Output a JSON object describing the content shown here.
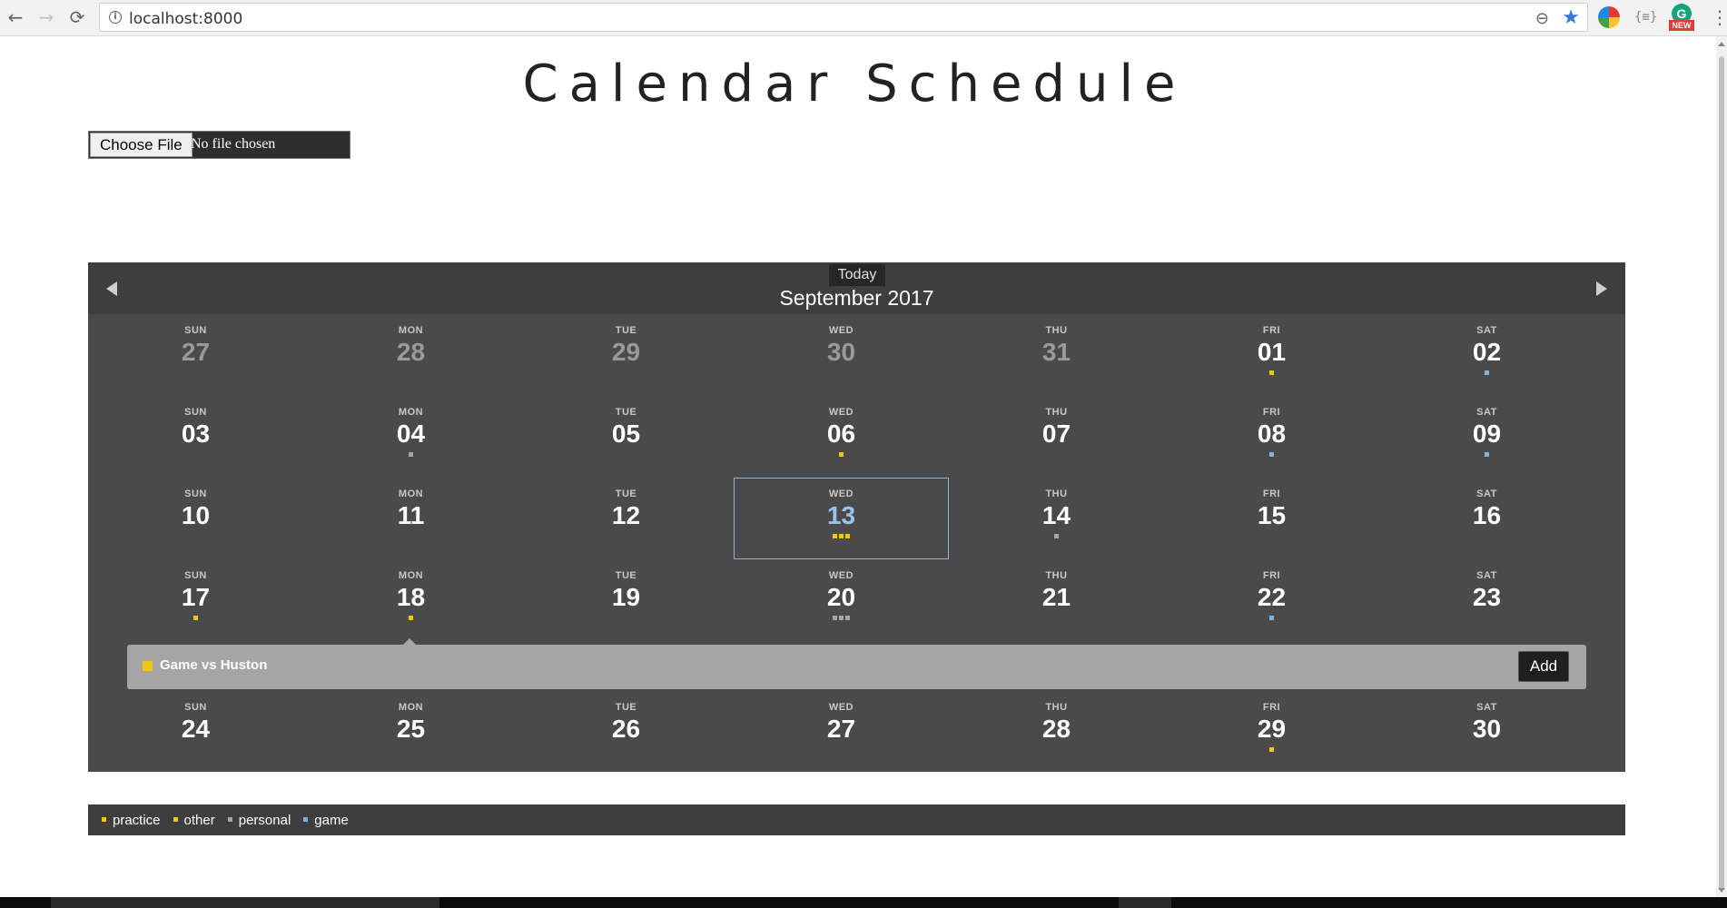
{
  "browser": {
    "url": "localhost:8000",
    "info_icon": "i",
    "back_icon": "←",
    "forward_icon": "→",
    "reload_icon": "⟳",
    "zoom_icon": "⊖",
    "star_icon": "★",
    "menu_icon": "⋮",
    "braces_icon": "{≡}",
    "grammarly_letter": "G",
    "grammarly_badge": "NEW"
  },
  "page": {
    "title": "Calendar Schedule",
    "file_input": {
      "button_label": "Choose File",
      "status": "No file chosen"
    }
  },
  "colors": {
    "practice": "#f0c419",
    "other": "#f0c419",
    "personal": "#a6a6a6",
    "game": "#7fb2e5"
  },
  "calendar": {
    "today_label": "Today",
    "month_label": "September 2017",
    "prev_icon": "triangle-left",
    "next_icon": "triangle-right",
    "weeks": [
      [
        {
          "name": "SUN",
          "num": "27",
          "other": true,
          "dots": []
        },
        {
          "name": "MON",
          "num": "28",
          "other": true,
          "dots": []
        },
        {
          "name": "TUE",
          "num": "29",
          "other": true,
          "dots": []
        },
        {
          "name": "WED",
          "num": "30",
          "other": true,
          "dots": []
        },
        {
          "name": "THU",
          "num": "31",
          "other": true,
          "dots": []
        },
        {
          "name": "FRI",
          "num": "01",
          "dots": [
            "#f0c419"
          ]
        },
        {
          "name": "SAT",
          "num": "02",
          "dots": [
            "#7fb2e5"
          ]
        }
      ],
      [
        {
          "name": "SUN",
          "num": "03",
          "dots": []
        },
        {
          "name": "MON",
          "num": "04",
          "dots": [
            "#a6a6a6"
          ]
        },
        {
          "name": "TUE",
          "num": "05",
          "dots": []
        },
        {
          "name": "WED",
          "num": "06",
          "dots": [
            "#f0c419"
          ]
        },
        {
          "name": "THU",
          "num": "07",
          "dots": []
        },
        {
          "name": "FRI",
          "num": "08",
          "dots": [
            "#7fb2e5"
          ]
        },
        {
          "name": "SAT",
          "num": "09",
          "dots": [
            "#7fb2e5"
          ]
        }
      ],
      [
        {
          "name": "SUN",
          "num": "10",
          "dots": []
        },
        {
          "name": "MON",
          "num": "11",
          "dots": []
        },
        {
          "name": "TUE",
          "num": "12",
          "dots": []
        },
        {
          "name": "WED",
          "num": "13",
          "selected": true,
          "dots": [
            "#f0c419",
            "#f0c419",
            "#f0c419"
          ]
        },
        {
          "name": "THU",
          "num": "14",
          "dots": [
            "#a6a6a6"
          ]
        },
        {
          "name": "FRI",
          "num": "15",
          "dots": []
        },
        {
          "name": "SAT",
          "num": "16",
          "dots": []
        }
      ],
      [
        {
          "name": "SUN",
          "num": "17",
          "dots": [
            "#f0c419"
          ]
        },
        {
          "name": "MON",
          "num": "18",
          "dots": [
            "#f0c419"
          ]
        },
        {
          "name": "TUE",
          "num": "19",
          "dots": []
        },
        {
          "name": "WED",
          "num": "20",
          "dots": [
            "#a6a6a6",
            "#a6a6a6",
            "#a6a6a6"
          ]
        },
        {
          "name": "THU",
          "num": "21",
          "dots": []
        },
        {
          "name": "FRI",
          "num": "22",
          "dots": [
            "#7fb2e5"
          ]
        },
        {
          "name": "SAT",
          "num": "23",
          "dots": []
        }
      ],
      [
        {
          "name": "SUN",
          "num": "24",
          "dots": []
        },
        {
          "name": "MON",
          "num": "25",
          "dots": []
        },
        {
          "name": "TUE",
          "num": "26",
          "dots": []
        },
        {
          "name": "WED",
          "num": "27",
          "dots": []
        },
        {
          "name": "THU",
          "num": "28",
          "dots": []
        },
        {
          "name": "FRI",
          "num": "29",
          "dots": [
            "#f0c419"
          ]
        },
        {
          "name": "SAT",
          "num": "30",
          "dots": []
        }
      ]
    ],
    "details": {
      "event_title": "Game vs Huston",
      "event_color": "#f0c419",
      "add_label": "Add"
    }
  },
  "legend": [
    {
      "label": "practice",
      "color": "#f0c419"
    },
    {
      "label": "other",
      "color": "#f0c419"
    },
    {
      "label": "personal",
      "color": "#a6a6a6"
    },
    {
      "label": "game",
      "color": "#7fb2e5"
    }
  ]
}
